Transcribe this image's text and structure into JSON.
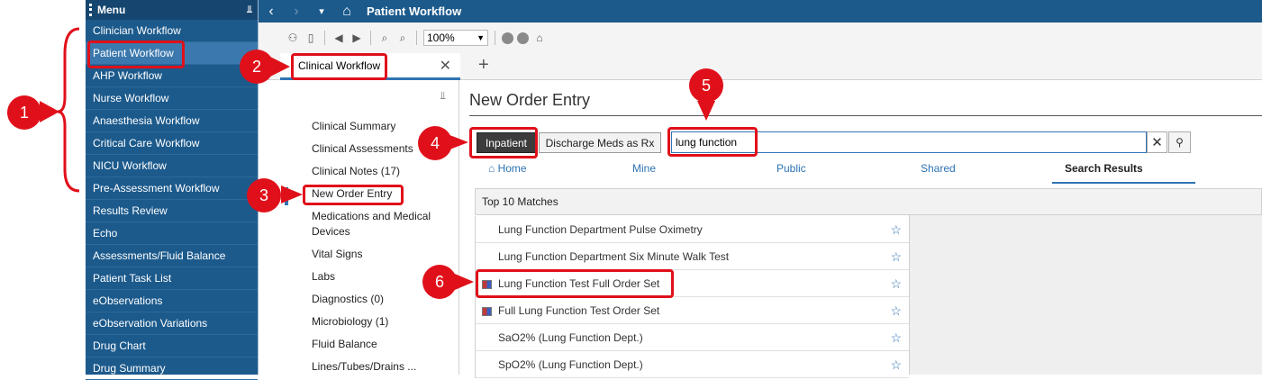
{
  "sidebar": {
    "header": "Menu",
    "items": [
      "Clinician Workflow",
      "Patient Workflow",
      "AHP Workflow",
      "Nurse Workflow",
      "Anaesthesia Workflow",
      "Critical Care Workflow",
      "NICU Workflow",
      "Pre-Assessment Workflow",
      "Results Review",
      "Echo",
      "Assessments/Fluid Balance",
      "Patient Task List",
      "eObservations",
      "eObservation Variations",
      "Drug Chart",
      "Drug Summary"
    ]
  },
  "topbar": {
    "title": "Patient Workflow"
  },
  "toolbar": {
    "zoom": "100%"
  },
  "tabs": {
    "active": "Clinical Workflow",
    "add": "+"
  },
  "leftnav": {
    "items": [
      "Clinical Summary",
      "Clinical Assessments",
      "Clinical Notes  (17)",
      "New Order Entry",
      "Medications and Medical",
      "Devices",
      "Vital Signs",
      "Labs",
      "Diagnostics  (0)",
      "Microbiology  (1)",
      "Fluid Balance",
      "Lines/Tubes/Drains ..."
    ]
  },
  "main": {
    "title": "New Order Entry",
    "buttons": {
      "inpatient": "Inpatient",
      "discharge": "Discharge Meds as Rx"
    },
    "search": {
      "value": "lung function"
    },
    "subtabs": {
      "home": "Home",
      "mine": "Mine",
      "public": "Public",
      "shared": "Shared",
      "results": "Search Results"
    },
    "results_header": "Top 10 Matches",
    "results": [
      "Lung Function Department Pulse Oximetry",
      "Lung Function Department Six Minute Walk Test",
      "Lung Function Test Full Order Set",
      "Full Lung Function Test Order Set",
      "SaO2% (Lung Function Dept.)",
      "SpO2% (Lung Function Dept.)"
    ]
  },
  "annotations": [
    "1",
    "2",
    "3",
    "4",
    "5",
    "6"
  ],
  "colors": {
    "brand": "#1c5a8c",
    "accent": "#2f74b5",
    "annotation": "#e0101a"
  }
}
